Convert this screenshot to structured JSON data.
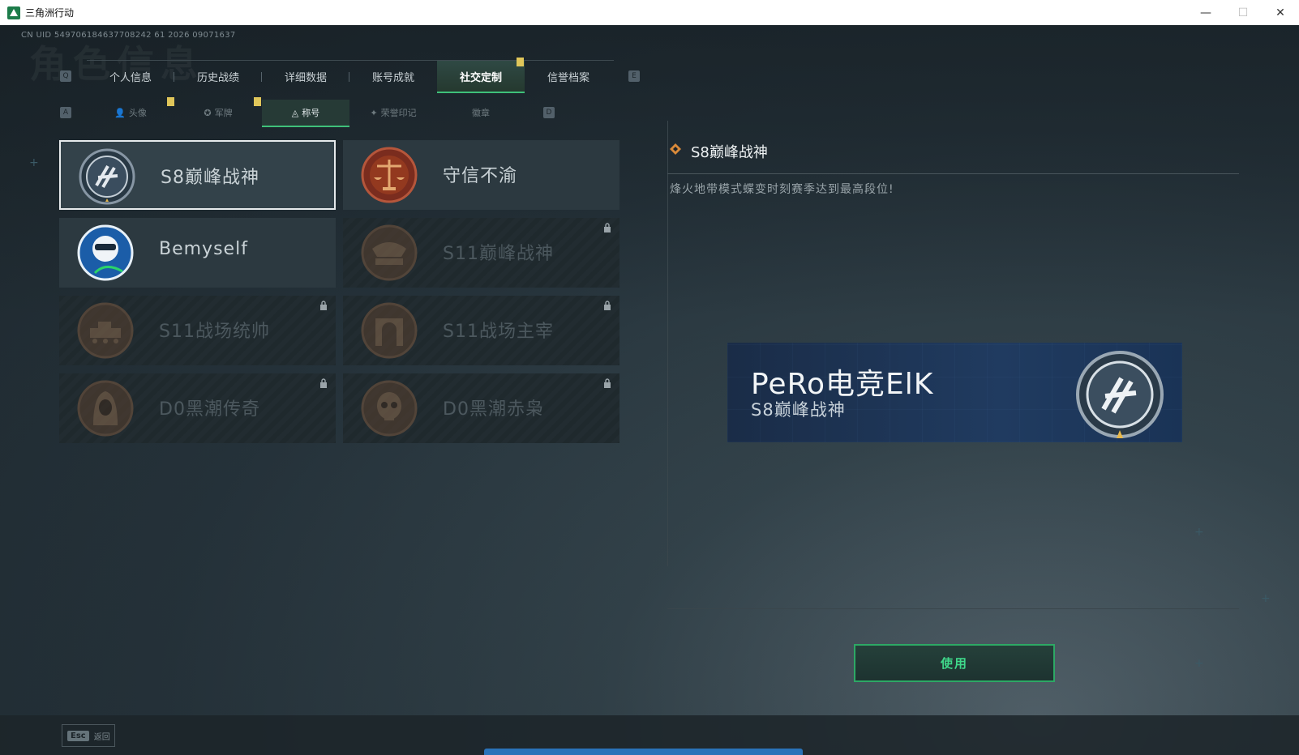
{
  "window": {
    "title": "三角洲行动",
    "controls": [
      "—",
      "☐",
      "✕"
    ]
  },
  "uid": "CN UID 549706184637708242 61 2026 09071637",
  "ghost_title": "角色信息",
  "keys": {
    "prev_tab": "Q",
    "next_tab": "E",
    "prev_sub": "A",
    "next_sub": "D"
  },
  "tabs": [
    {
      "label": "个人信息",
      "active": false
    },
    {
      "label": "历史战绩",
      "active": false
    },
    {
      "label": "详细数据",
      "active": false
    },
    {
      "label": "账号成就",
      "active": false
    },
    {
      "label": "社交定制",
      "active": true
    },
    {
      "label": "信誉档案",
      "active": false
    }
  ],
  "subtabs": [
    {
      "label": "头像",
      "icon": "person-icon",
      "active": false
    },
    {
      "label": "军牌",
      "icon": "military-tag-icon",
      "active": false
    },
    {
      "label": "称号",
      "icon": "title-icon",
      "active": true
    },
    {
      "label": "荣誉印记",
      "icon": "honor-mark-icon",
      "active": false
    },
    {
      "label": "徽章",
      "icon": "badge-icon",
      "active": false
    }
  ],
  "titles": [
    {
      "label": "S8巅峰战神",
      "emblem": "s8-peak-emblem",
      "locked": false,
      "selected": true
    },
    {
      "label": "守信不渝",
      "emblem": "scales-emblem",
      "locked": false,
      "selected": false
    },
    {
      "label": "Bemyself",
      "emblem": "bemyself-emblem",
      "locked": false,
      "selected": false
    },
    {
      "label": "S11巅峰战神",
      "emblem": "s11-peak-emblem",
      "locked": true,
      "selected": false
    },
    {
      "label": "S11战场统帅",
      "emblem": "tank-emblem",
      "locked": true,
      "selected": false
    },
    {
      "label": "S11战场主宰",
      "emblem": "arch-emblem",
      "locked": true,
      "selected": false
    },
    {
      "label": "D0黑潮传奇",
      "emblem": "hooded-emblem",
      "locked": true,
      "selected": false
    },
    {
      "label": "D0黑潮赤枭",
      "emblem": "skull-emblem",
      "locked": true,
      "selected": false
    }
  ],
  "detail": {
    "title": "S8巅峰战神",
    "description": "烽火地带模式蝶变时刻赛季达到最高段位!"
  },
  "preview": {
    "player_name": "PeRo电竞ElK",
    "title": "S8巅峰战神"
  },
  "use_button": "使用",
  "back": {
    "key": "Esc",
    "label": "返回"
  },
  "colors": {
    "accent": "#3fc07a",
    "badge": "#e0c65a",
    "banner": "#203b60"
  }
}
